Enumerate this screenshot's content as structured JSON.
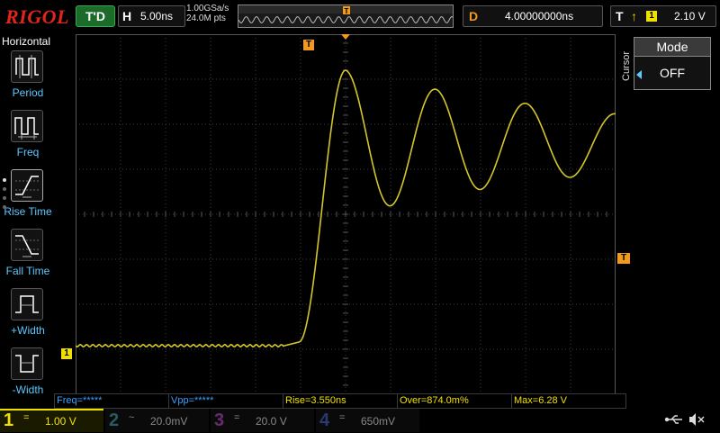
{
  "header": {
    "brand": "RIGOL",
    "run_status": "T'D",
    "horizontal": {
      "label": "H",
      "value": "5.00ns"
    },
    "sample_rate": "1.00GSa/s",
    "memory_depth": "24.0M pts",
    "delay": {
      "label": "D",
      "value": "4.00000000ns"
    },
    "trigger": {
      "label": "T",
      "edge": "rising-edge-icon",
      "source": "1",
      "level": "2.10 V"
    }
  },
  "left_menu": {
    "title": "Horizontal",
    "items": [
      {
        "label": "Period",
        "icon": "period-icon"
      },
      {
        "label": "Freq",
        "icon": "frequency-icon"
      },
      {
        "label": "Rise Time",
        "icon": "rise-time-icon"
      },
      {
        "label": "Fall Time",
        "icon": "fall-time-icon"
      },
      {
        "label": "+Width",
        "icon": "positive-width-icon"
      },
      {
        "label": "-Width",
        "icon": "negative-width-icon"
      }
    ]
  },
  "cursor_panel": {
    "title": "Cursor",
    "mode_label": "Mode",
    "mode_value": "OFF"
  },
  "markers": {
    "trigger_marker": "T",
    "channel1_marker": "1",
    "trigger_level_marker": "T"
  },
  "measurements": [
    {
      "text": "Freq=*****",
      "color": "#3aa0ff"
    },
    {
      "text": "Vpp=*****",
      "color": "#3aa0ff"
    },
    {
      "text": "Rise=3.550ns",
      "color": "#f0e000"
    },
    {
      "text": "Over=874.0m%",
      "color": "#f0e000"
    },
    {
      "text": "Max=6.28 V",
      "color": "#f0e000"
    }
  ],
  "channels": [
    {
      "num": "1",
      "coupling": "=",
      "scale": "1.00 V",
      "color": "#f0e000",
      "active": true
    },
    {
      "num": "2",
      "coupling": "~",
      "scale": "20.0mV",
      "color": "#26c6da",
      "active": false
    },
    {
      "num": "3",
      "coupling": "=",
      "scale": "20.0 V",
      "color": "#e040fb",
      "active": false
    },
    {
      "num": "4",
      "coupling": "=",
      "scale": "650mV",
      "color": "#2f6bff",
      "active": false
    }
  ],
  "colors": {
    "ch1_trace": "#d4c62a",
    "trigger_orange": "#f39a1d",
    "brand_red": "#e0251b",
    "menu_label": "#5cc8ff"
  }
}
